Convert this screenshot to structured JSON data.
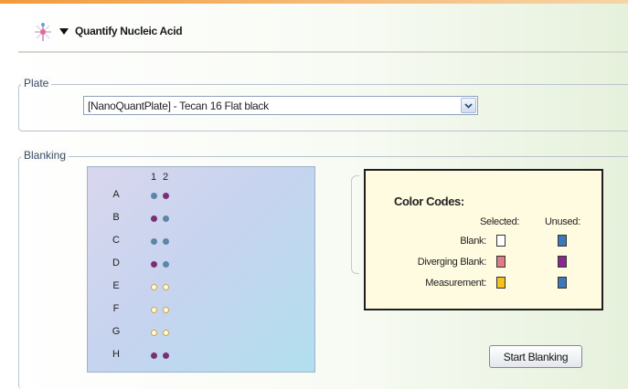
{
  "header": {
    "title": "Quantify Nucleic Acid",
    "icon": "dna-tool-icon",
    "toggle_icon": "collapse-triangle-icon"
  },
  "plate": {
    "legend": "Plate",
    "select_value": "[NanoQuantPlate] - Tecan 16 Flat black",
    "dropdown_icon": "chevron-down-icon"
  },
  "blanking": {
    "legend": "Blanking",
    "columns": [
      "1",
      "2"
    ],
    "rows": [
      {
        "label": "A",
        "wells": [
          "blank",
          "diverging"
        ]
      },
      {
        "label": "B",
        "wells": [
          "diverging",
          "blank"
        ]
      },
      {
        "label": "C",
        "wells": [
          "blank",
          "blank"
        ]
      },
      {
        "label": "D",
        "wells": [
          "diverging",
          "blank"
        ]
      },
      {
        "label": "E",
        "wells": [
          "measurement",
          "measurement"
        ]
      },
      {
        "label": "F",
        "wells": [
          "measurement",
          "measurement"
        ]
      },
      {
        "label": "G",
        "wells": [
          "measurement",
          "measurement"
        ]
      },
      {
        "label": "H",
        "wells": [
          "diverging",
          "diverging"
        ]
      }
    ],
    "well_colors": {
      "blank": "#5b86a8",
      "diverging": "#7b2f72",
      "measurement": "#fffbe6"
    },
    "start_button": "Start Blanking"
  },
  "color_codes": {
    "title": "Color Codes:",
    "selected_header": "Selected:",
    "unused_header": "Unused:",
    "items": [
      {
        "label": "Blank:",
        "selected_color": "#ffffff",
        "unused_color": "#3d79b8"
      },
      {
        "label": "Diverging Blank:",
        "selected_color": "#e07a86",
        "unused_color": "#8a2a8f"
      },
      {
        "label": "Measurement:",
        "selected_color": "#f5c21b",
        "unused_color": "#3d79b8"
      }
    ]
  }
}
